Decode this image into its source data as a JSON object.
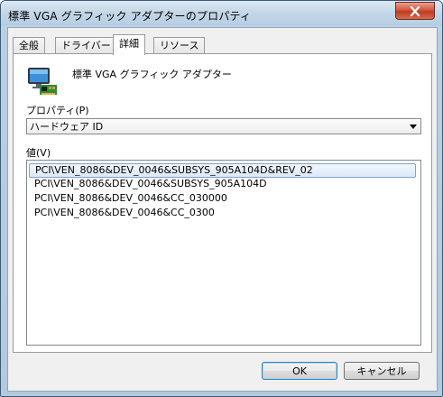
{
  "window": {
    "title": "標準 VGA グラフィック アダプターのプロパティ"
  },
  "tabs": [
    {
      "label": "全般"
    },
    {
      "label": "ドライバー"
    },
    {
      "label": "詳細"
    },
    {
      "label": "リソース"
    }
  ],
  "active_tab": "詳細",
  "device": {
    "name": "標準 VGA グラフィック アダプター",
    "icon": "display-adapter-icon"
  },
  "property": {
    "label": "プロパティ(P)",
    "selected": "ハードウェア ID"
  },
  "values": {
    "label": "値(V)",
    "items": [
      "PCI\\VEN_8086&DEV_0046&SUBSYS_905A104D&REV_02",
      "PCI\\VEN_8086&DEV_0046&SUBSYS_905A104D",
      "PCI\\VEN_8086&DEV_0046&CC_030000",
      "PCI\\VEN_8086&DEV_0046&CC_0300"
    ],
    "selected_index": 0
  },
  "buttons": {
    "ok": "OK",
    "cancel": "キャンセル"
  }
}
